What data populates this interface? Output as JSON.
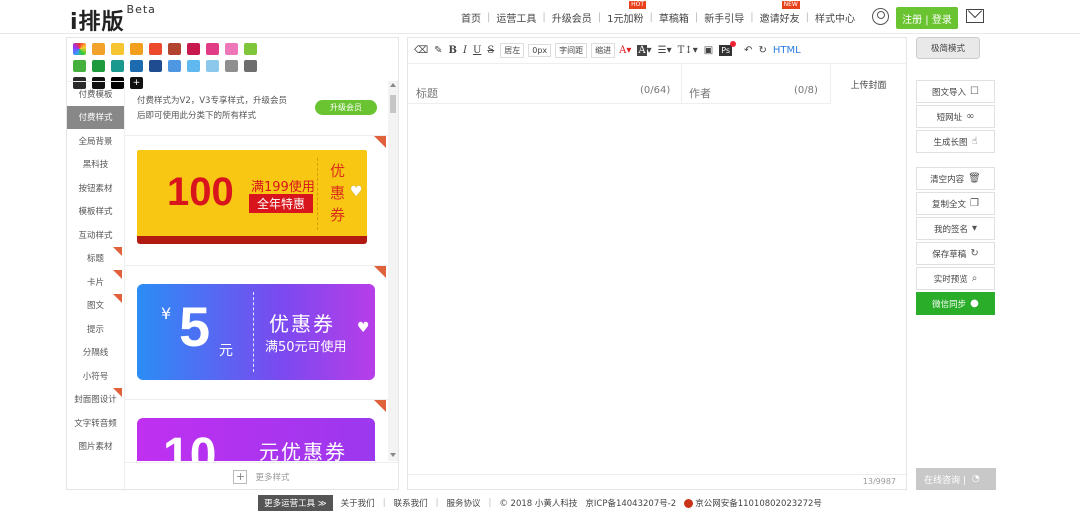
{
  "header": {
    "logo": "i排版",
    "logo_badge": "Beta",
    "nav": [
      {
        "label": "首页",
        "tag": ""
      },
      {
        "label": "运营工具",
        "tag": ""
      },
      {
        "label": "升级会员",
        "tag": ""
      },
      {
        "label": "1元加粉",
        "tag": "HOT"
      },
      {
        "label": "草稿箱",
        "tag": ""
      },
      {
        "label": "新手引导",
        "tag": ""
      },
      {
        "label": "邀请好友",
        "tag": "NEW"
      },
      {
        "label": "样式中心",
        "tag": ""
      }
    ],
    "register_login": "注册 | 登录"
  },
  "palette": [
    "#f2a22b",
    "#f6c431",
    "#f39f1e",
    "#ec4a2c",
    "#b2442f",
    "#c8194f",
    "#e13d86",
    "#ef76b9",
    "#7fc63b",
    "#46b03f",
    "#1e9a3c",
    "#1a9a8e",
    "#1c6bb0",
    "#1f4b90",
    "#4f97e3",
    "#5fb8ee",
    "#8bc8ec",
    "#8f8f8f",
    "#6e6e6e",
    "#2b2b2b",
    "#111111",
    "#000000"
  ],
  "palette_first": "multicolor",
  "sidebar": {
    "items": [
      {
        "label": "付费模板",
        "active": false,
        "corner": false
      },
      {
        "label": "付费样式",
        "active": true,
        "corner": false
      },
      {
        "label": "全局背景",
        "active": false,
        "corner": false
      },
      {
        "label": "黑科技",
        "active": false,
        "corner": false
      },
      {
        "label": "按钮素材",
        "active": false,
        "corner": false
      },
      {
        "label": "模板样式",
        "active": false,
        "corner": false
      },
      {
        "label": "互动样式",
        "active": false,
        "corner": false
      },
      {
        "label": "标题",
        "active": false,
        "corner": true
      },
      {
        "label": "卡片",
        "active": false,
        "corner": true
      },
      {
        "label": "图文",
        "active": false,
        "corner": true
      },
      {
        "label": "提示",
        "active": false,
        "corner": false
      },
      {
        "label": "分隔线",
        "active": false,
        "corner": false
      },
      {
        "label": "小符号",
        "active": false,
        "corner": false
      },
      {
        "label": "封面图设计",
        "active": false,
        "corner": true
      },
      {
        "label": "文字转音频",
        "active": false,
        "corner": false
      },
      {
        "label": "图片素材",
        "active": false,
        "corner": false
      }
    ]
  },
  "styles_panel": {
    "vip_note_1": "付费样式为V2，V3专享样式，升级会员",
    "vip_note_2": "后即可使用此分类下的所有样式",
    "upgrade_label": "升级会员",
    "more_label": "更多样式"
  },
  "coupons": {
    "c1_amount": "100",
    "c1_condition": "满199使用",
    "c1_tag": "全年特惠",
    "c1_vertical": "优惠券",
    "c2_currency": "¥",
    "c2_amount": "5",
    "c2_unit": "元",
    "c2_title": "优惠券",
    "c2_condition": "满50元可使用",
    "c3_amount": "10",
    "c3_title": "元优惠券"
  },
  "toolbar": {
    "bold": "B",
    "italic": "I",
    "underline": "U",
    "strike": "S",
    "align_label": "居左",
    "indent_value": "0px",
    "letter_spacing": "字间距",
    "indent_label": "缩进",
    "font_color": "A",
    "bg_color": "A",
    "font_size": "T",
    "ps_label": "Ps",
    "html_label": "HTML"
  },
  "editor": {
    "title_placeholder": "标题",
    "title_count": "(0/64)",
    "author_placeholder": "作者",
    "author_count": "(0/8)",
    "cover_label": "上传封面",
    "char_count": "13/9987"
  },
  "right_panel": {
    "simple_mode": "极简模式",
    "import": "图文导入",
    "short_url": "短网址",
    "long_image": "生成长图",
    "clear": "清空内容",
    "copy_all": "复制全文",
    "signature": "我的签名",
    "save_draft": "保存草稿",
    "preview": "实时预览",
    "wechat_sync": "微信同步",
    "online_chat": "在线咨询 |"
  },
  "footer": {
    "more_tools": "更多运营工具 ≫",
    "about": "关于我们",
    "contact": "联系我们",
    "agreement": "服务协议",
    "copyright": "© 2018 小黄人科技",
    "icp": "京ICP备14043207号-2",
    "police": "京公网安备11010802023272号"
  }
}
